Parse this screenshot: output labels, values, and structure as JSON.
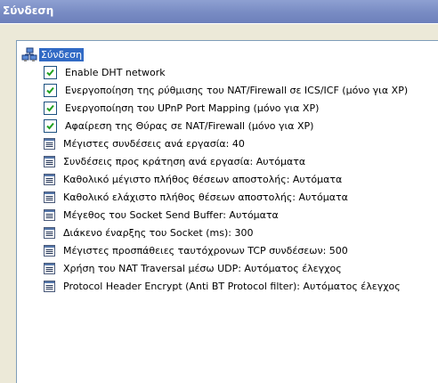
{
  "window": {
    "title": "Σύνδεση"
  },
  "tree": {
    "root_label": "Σύνδεση",
    "items": [
      {
        "type": "checkbox",
        "checked": true,
        "label": "Enable DHT network"
      },
      {
        "type": "checkbox",
        "checked": true,
        "label": "Ενεργοποίηση της ρύθμισης του NAT/Firewall σε ICS/ICF (μόνο για XP)"
      },
      {
        "type": "checkbox",
        "checked": true,
        "label": "Ενεργοποίηση του UPnP Port Mapping (μόνο για XP)"
      },
      {
        "type": "checkbox",
        "checked": true,
        "label": "Αφαίρεση της Θύρας σε NAT/Firewall (μόνο για XP)"
      },
      {
        "type": "setting",
        "label": "Μέγιστες συνδέσεις ανά εργασία: 40"
      },
      {
        "type": "setting",
        "label": "Συνδέσεις προς κράτηση ανά εργασία: Αυτόματα"
      },
      {
        "type": "setting",
        "label": "Καθολικό μέγιστο πλήθος θέσεων αποστολής: Αυτόματα"
      },
      {
        "type": "setting",
        "label": "Καθολικό ελάχιστο πλήθος θέσεων αποστολής: Αυτόματα"
      },
      {
        "type": "setting",
        "label": "Μέγεθος του Socket Send Buffer: Αυτόματα"
      },
      {
        "type": "setting",
        "label": "Διάκενο έναρξης του Socket (ms): 300"
      },
      {
        "type": "setting",
        "label": "Μέγιστες προσπάθειες ταυτόχρονων TCP συνδέσεων: 500"
      },
      {
        "type": "setting",
        "label": "Χρήση του NAT Traversal μέσω UDP: Αυτόματος έλεγχος"
      },
      {
        "type": "setting",
        "label": "Protocol Header Encrypt (Anti BT Protocol filter): Αυτόματος έλεγχος"
      }
    ]
  },
  "icons": {
    "root": "network-computers-icon",
    "checkbox": "checkbox-icon",
    "setting": "settings-list-icon"
  },
  "colors": {
    "title_bar": "#7a8dc4",
    "selection": "#316ac5",
    "checkbox_check": "#21a121",
    "background": "#ece9d8"
  }
}
